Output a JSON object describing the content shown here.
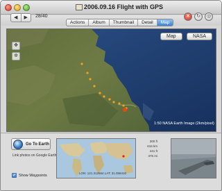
{
  "window": {
    "title": "2006.09.16 Flight with GPS"
  },
  "toolbar": {
    "back_label": "◀",
    "forward_label": "▶",
    "counter": "28/40",
    "stop_glyph": "✕",
    "refresh_glyph": "↻",
    "target_glyph": "◎"
  },
  "tabs": [
    {
      "label": "Actions",
      "active": false
    },
    {
      "label": "Album",
      "active": false
    },
    {
      "label": "Thumbnail",
      "active": false
    },
    {
      "label": "Detail",
      "active": false
    },
    {
      "label": "Map",
      "active": true
    }
  ],
  "map": {
    "toggle_map": "Map",
    "toggle_nasa": "NASA",
    "caption": "1:50 NASA Earth Image (2km/pixel)",
    "track_color": "#f5a21a",
    "current_point_color": "#e64a12"
  },
  "bottom": {
    "goto_label": "Go To Earth",
    "link_text": "Link photos on Google Earth",
    "show_waypoints_label": "Show Waypoints",
    "show_waypoints_checked": true,
    "stats": [
      "300 ft",
      "616 km",
      "441 ft",
      "375 mi"
    ],
    "coords": "LON: 121.312664  LAT: 31.058410"
  }
}
